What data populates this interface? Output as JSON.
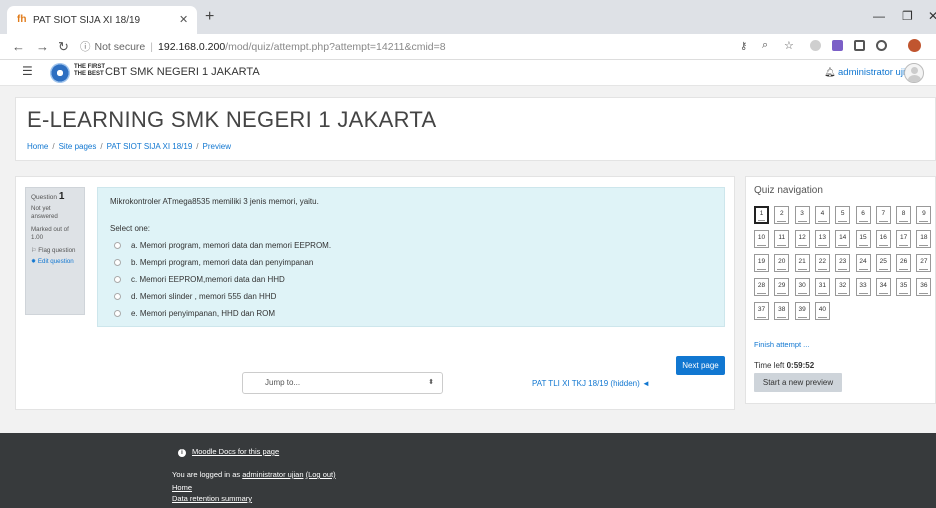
{
  "browser": {
    "tab_title": "PAT SIOT SIJA XI 18/19",
    "tab_favicon": "fh",
    "security_label": "Not secure",
    "url_host": "192.168.0.200",
    "url_path": "/mod/quiz/attempt.php?attempt=14211&cmid=8"
  },
  "navbar": {
    "logo_text": [
      "THE FIRST",
      "THE BEST"
    ],
    "brand": "CBT SMK NEGERI 1 JAKARTA",
    "user": "administrator ujian"
  },
  "header": {
    "title": "E-LEARNING SMK NEGERI 1 JAKARTA",
    "breadcrumb": [
      "Home",
      "Site pages",
      "PAT SIOT SIJA XI 18/19",
      "Preview"
    ]
  },
  "question": {
    "label": "Question",
    "number": "1",
    "status": "Not yet answered",
    "mark": "Marked out of 1.00",
    "flag": "Flag question",
    "edit": "Edit question",
    "text": "Mikrokontroler ATmega8535 memiliki 3 jenis memori, yaitu.",
    "select_one": "Select one:",
    "options": [
      "a. Memori program, memori data dan memori EEPROM.",
      "b. Mempri program, memori data dan penyimpanan",
      "c. Memori EEPROM,memori data dan HHD",
      "d. Memori slinder , memori 555 dan HHD",
      "e. Memori penyimpanan, HHD dan ROM"
    ]
  },
  "actions": {
    "next_page": "Next page",
    "jump_placeholder": "Jump to...",
    "prev_activity": "PAT TLI XI TKJ 18/19 (hidden) ◄"
  },
  "quiz_nav": {
    "title": "Quiz navigation",
    "questions": [
      "1",
      "2",
      "3",
      "4",
      "5",
      "6",
      "7",
      "8",
      "9",
      "10",
      "11",
      "12",
      "13",
      "14",
      "15",
      "16",
      "17",
      "18",
      "19",
      "20",
      "21",
      "22",
      "23",
      "24",
      "25",
      "26",
      "27",
      "28",
      "29",
      "30",
      "31",
      "32",
      "33",
      "34",
      "35",
      "36",
      "37",
      "38",
      "39",
      "40"
    ],
    "current": "1",
    "finish": "Finish attempt ...",
    "time_label": "Time left",
    "time_value": "0:59:52",
    "new_preview": "Start a new preview"
  },
  "footer": {
    "docs": "Moodle Docs for this page",
    "logged_prefix": "You are logged in as",
    "logged_user": "administrator ujian",
    "logout": "(Log out)",
    "home": "Home",
    "data_retention": "Data retention summary"
  },
  "colors": {
    "link": "#1177d1",
    "question_bg": "#dff3f7",
    "footer_bg": "#373a3c"
  }
}
